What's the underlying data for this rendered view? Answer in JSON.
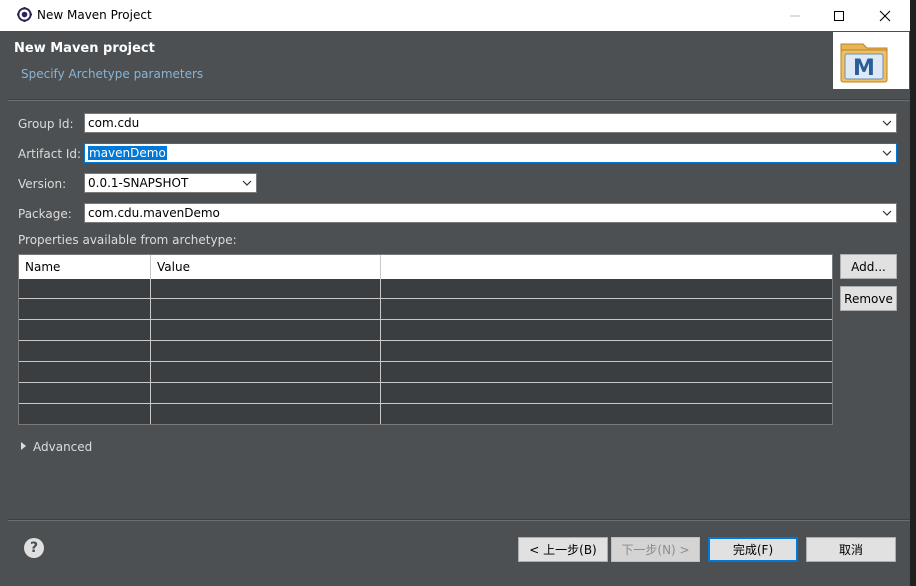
{
  "window": {
    "title": "New Maven Project",
    "minimize_icon": "minimize-icon",
    "maximize_icon": "maximize-icon",
    "close_icon": "close-icon"
  },
  "header": {
    "title": "New Maven project",
    "subtitle": "Specify Archetype parameters",
    "logo_letter": "M"
  },
  "form": {
    "group_id": {
      "label": "Group Id:",
      "value": "com.cdu"
    },
    "artifact_id": {
      "label": "Artifact Id:",
      "value": "mavenDemo"
    },
    "version": {
      "label": "Version:",
      "value": "0.0.1-SNAPSHOT"
    },
    "package": {
      "label": "Package:",
      "value": "com.cdu.mavenDemo"
    }
  },
  "properties": {
    "label": "Properties available from archetype:",
    "columns": [
      "Name",
      "Value",
      ""
    ],
    "rows": [],
    "add_label": "Add...",
    "remove_label": "Remove"
  },
  "advanced": {
    "label": "Advanced"
  },
  "footer": {
    "help_glyph": "?",
    "back_label": "< 上一步(B)",
    "next_label": "下一步(N) >",
    "finish_label": "完成(F)",
    "cancel_label": "取消"
  },
  "colors": {
    "accent": "#0078d7",
    "background": "#4c5052",
    "subtitle": "#8ab4d4"
  }
}
